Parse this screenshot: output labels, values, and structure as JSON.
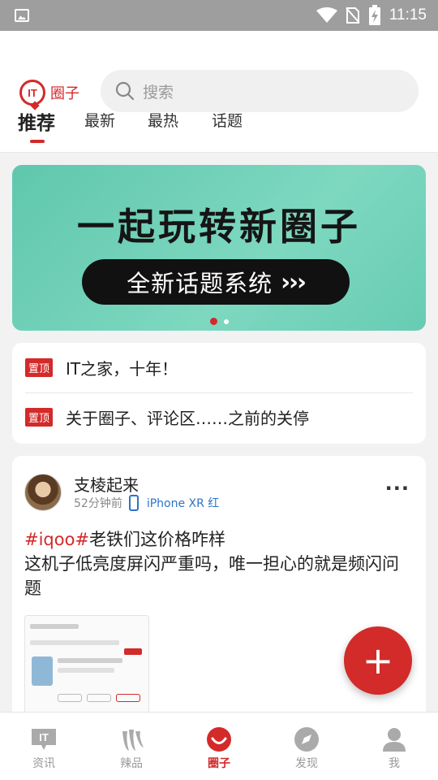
{
  "status_bar": {
    "time": "11:15"
  },
  "header": {
    "logo_text": "圈子",
    "logo_mark": "IT",
    "search_placeholder": "搜索",
    "tabs": [
      {
        "label": "推荐",
        "active": true
      },
      {
        "label": "最新",
        "active": false
      },
      {
        "label": "最热",
        "active": false
      },
      {
        "label": "话题",
        "active": false
      }
    ]
  },
  "banner": {
    "title": "一起玩转新圈子",
    "subtitle": "全新话题系统",
    "arrows": "›››",
    "slide_index": 1,
    "slide_count": 2
  },
  "pinned": [
    {
      "badge": "置顶",
      "text": "IT之家，十年！"
    },
    {
      "badge": "置顶",
      "text": "关于圈子、评论区……之前的关停"
    }
  ],
  "post": {
    "username": "支棱起来",
    "time": "52分钟前",
    "device": "iPhone XR 红",
    "hashtag": "#iqoo#",
    "title_rest": "老铁们这价格咋样",
    "body": "这机子低亮度屏闪严重吗，唯一担心的就是频闪问题",
    "more_label": "···"
  },
  "fab_label": "+",
  "bottom_nav": [
    {
      "label": "资讯",
      "icon": "it-news-icon",
      "active": false
    },
    {
      "label": "辣品",
      "icon": "chili-icon",
      "active": false
    },
    {
      "label": "圈子",
      "icon": "circle-smile-icon",
      "active": true
    },
    {
      "label": "发现",
      "icon": "compass-icon",
      "active": false
    },
    {
      "label": "我",
      "icon": "person-icon",
      "active": false
    }
  ],
  "colors": {
    "accent": "#d32a2a",
    "banner": "#6fd0b8",
    "link": "#2d73c7"
  }
}
